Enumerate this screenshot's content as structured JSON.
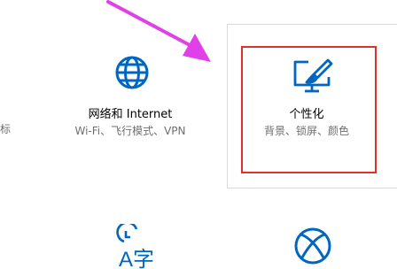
{
  "left_cutoff_label": "标",
  "tiles": {
    "network": {
      "title": "网络和 Internet",
      "subtitle": "Wi-Fi、飞行模式、VPN",
      "icon": "globe-icon"
    },
    "personalization": {
      "title": "个性化",
      "subtitle": "背景、锁屏、颜色",
      "icon": "monitor-paintbrush-icon"
    },
    "time_language": {
      "icon": "time-language-icon",
      "glyph": "A字"
    },
    "gaming": {
      "icon": "xbox-icon"
    }
  },
  "colors": {
    "accent": "#0067c0",
    "highlight": "#e0302c",
    "arrow": "#e040e8"
  }
}
